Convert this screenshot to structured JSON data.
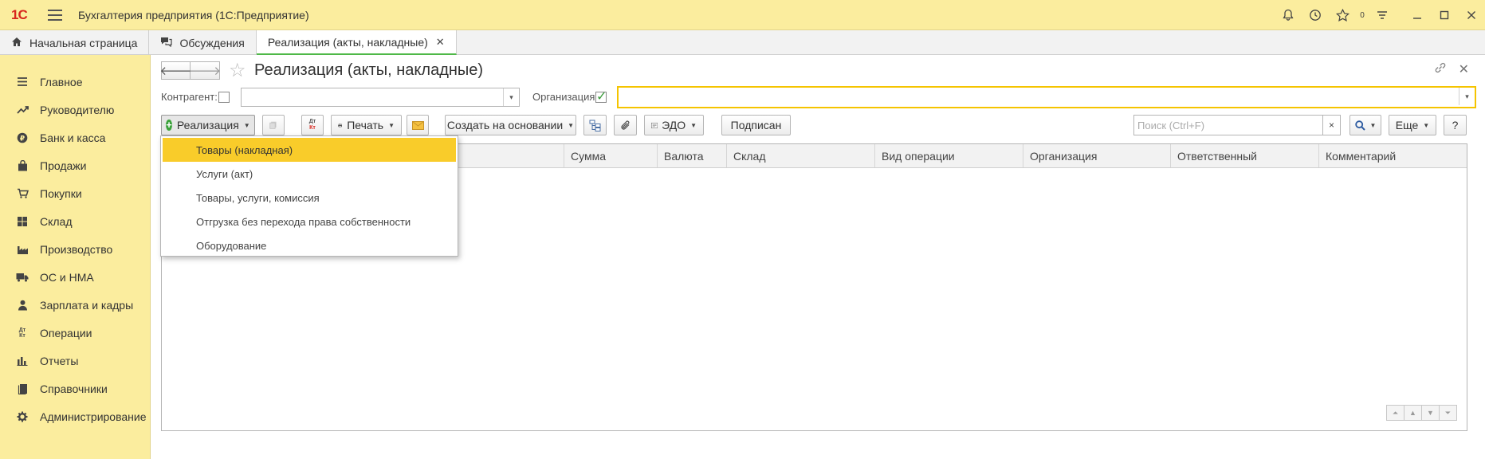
{
  "titlebar": {
    "logo": "1С",
    "title": "Бухгалтерия предприятия  (1С:Предприятие)",
    "notification_count": "0"
  },
  "tabs": [
    {
      "label": "Начальная страница",
      "icon": "home-icon"
    },
    {
      "label": "Обсуждения",
      "icon": "discussions-icon"
    },
    {
      "label": "Реализация (акты, накладные)",
      "active": true
    }
  ],
  "sidebar": {
    "items": [
      {
        "label": "Главное",
        "icon": "menu-lines-icon"
      },
      {
        "label": "Руководителю",
        "icon": "trend-icon"
      },
      {
        "label": "Банк и касса",
        "icon": "ruble-icon"
      },
      {
        "label": "Продажи",
        "icon": "shopping-bag-icon"
      },
      {
        "label": "Покупки",
        "icon": "cart-icon"
      },
      {
        "label": "Склад",
        "icon": "warehouse-icon"
      },
      {
        "label": "Производство",
        "icon": "factory-icon"
      },
      {
        "label": "ОС и НМА",
        "icon": "truck-icon"
      },
      {
        "label": "Зарплата и кадры",
        "icon": "person-icon"
      },
      {
        "label": "Операции",
        "icon": "dt-kt-icon"
      },
      {
        "label": "Отчеты",
        "icon": "bar-chart-icon"
      },
      {
        "label": "Справочники",
        "icon": "book-icon"
      },
      {
        "label": "Администрирование",
        "icon": "gear-icon"
      }
    ]
  },
  "form": {
    "title": "Реализация (акты, накладные)",
    "filters": {
      "counterparty_label": "Контрагент:",
      "counterparty_value": "",
      "counterparty_checked": false,
      "organization_label": "Организация:",
      "organization_value": "",
      "organization_checked": true
    },
    "toolbar": {
      "create_label": "Реализация",
      "print_label": "Печать",
      "create_based_label": "Создать на основании",
      "edo_label": "ЭДО",
      "signed_label": "Подписан",
      "search_placeholder": "Поиск (Ctrl+F)",
      "search_clear": "×",
      "more_label": "Еще",
      "help_label": "?",
      "dtkt_label": "Дт\nКт"
    },
    "table": {
      "columns": [
        "Сумма",
        "Валюта",
        "Склад",
        "Вид операции",
        "Организация",
        "Ответственный",
        "Комментарий"
      ],
      "rows": []
    },
    "dropdown": {
      "items": [
        {
          "label": "Товары (накладная)",
          "selected": true
        },
        {
          "label": "Услуги (акт)"
        },
        {
          "label": "Товары, услуги, комиссия"
        },
        {
          "label": "Отгрузка без перехода права собственности"
        },
        {
          "label": "Оборудование"
        }
      ]
    }
  },
  "colors": {
    "accent_yellow": "#fbed9e",
    "selection_yellow": "#f9cc2a",
    "active_tab_underline": "#4fb848",
    "logo_red": "#d8261d"
  }
}
